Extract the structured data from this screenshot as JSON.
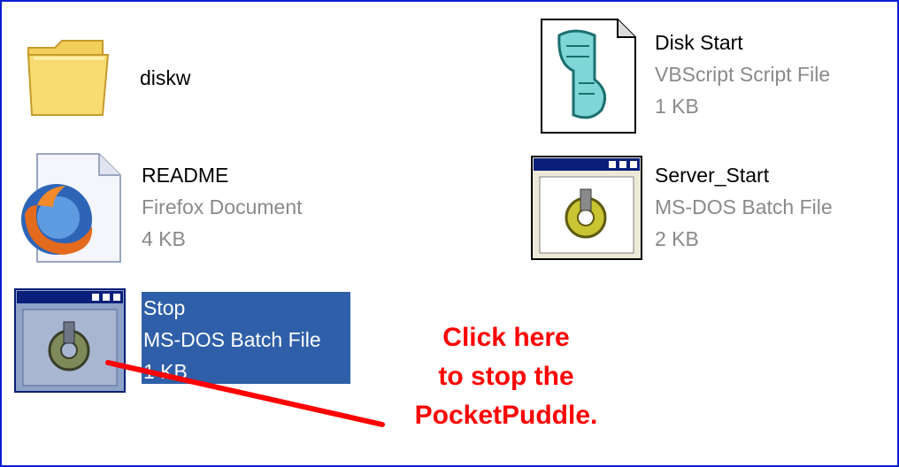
{
  "files": [
    {
      "name": "diskw",
      "icon": "folder-icon"
    },
    {
      "name": "Disk Start",
      "type": "VBScript Script File",
      "size": "1 KB",
      "icon": "vbscript-icon"
    },
    {
      "name": "README",
      "type": "Firefox Document",
      "size": "4 KB",
      "icon": "firefox-document-icon"
    },
    {
      "name": "Server_Start",
      "type": "MS-DOS Batch File",
      "size": "2 KB",
      "icon": "batch-file-icon"
    },
    {
      "name": "Stop",
      "type": "MS-DOS Batch File",
      "size": "1 KB",
      "icon": "batch-file-icon",
      "selected": true
    }
  ],
  "annotation": {
    "line1": "Click here",
    "line2": "to stop the",
    "line3": "PocketPuddle.",
    "color": "#ff0000"
  },
  "colors": {
    "selection": "#2f5fa8",
    "border": "#0b1fd0"
  }
}
